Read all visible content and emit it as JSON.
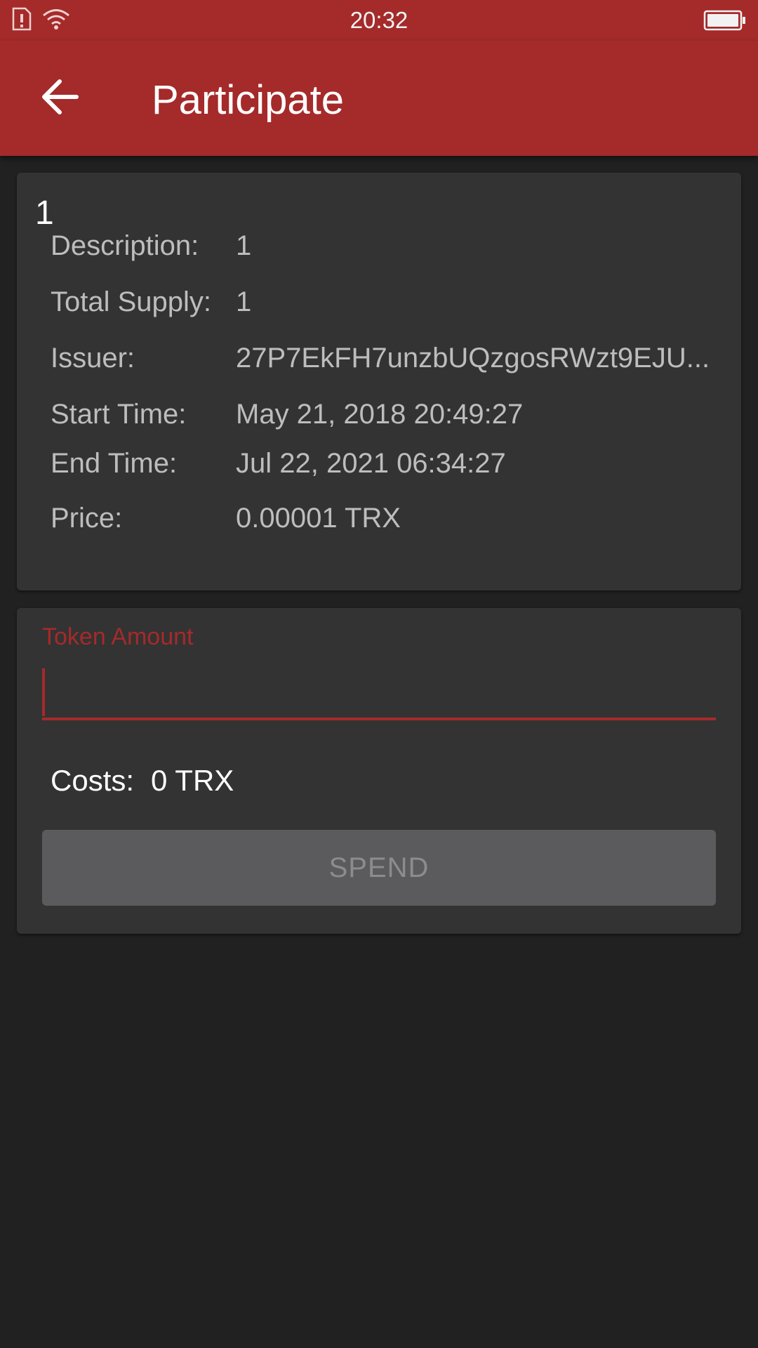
{
  "status_bar": {
    "time": "20:32",
    "icons": [
      "sim-alert-icon",
      "wifi-icon",
      "battery-icon"
    ]
  },
  "app_bar": {
    "title": "Participate",
    "back_icon": "arrow-back-icon"
  },
  "token": {
    "name": "1",
    "rows": [
      {
        "label": "Description:",
        "value": "1"
      },
      {
        "label": "Total Supply:",
        "value": "1"
      },
      {
        "label": "Issuer:",
        "value": "27P7EkFH7unzbUQzgosRWzt9EJU..."
      },
      {
        "label": "Start Time:",
        "value": "May 21, 2018 20:49:27"
      },
      {
        "label": "End Time:",
        "value": "Jul 22, 2021 06:34:27"
      },
      {
        "label": "Price:",
        "value": "0.00001 TRX"
      }
    ]
  },
  "participate": {
    "field_label": "Token Amount",
    "input_value": "",
    "costs_label": "Costs:",
    "costs_value": "0 TRX",
    "spend_label": "SPEND"
  },
  "colors": {
    "primary": "#a52a2a",
    "background": "#212121",
    "card": "#333333",
    "button_disabled": "#5b5b5d"
  }
}
